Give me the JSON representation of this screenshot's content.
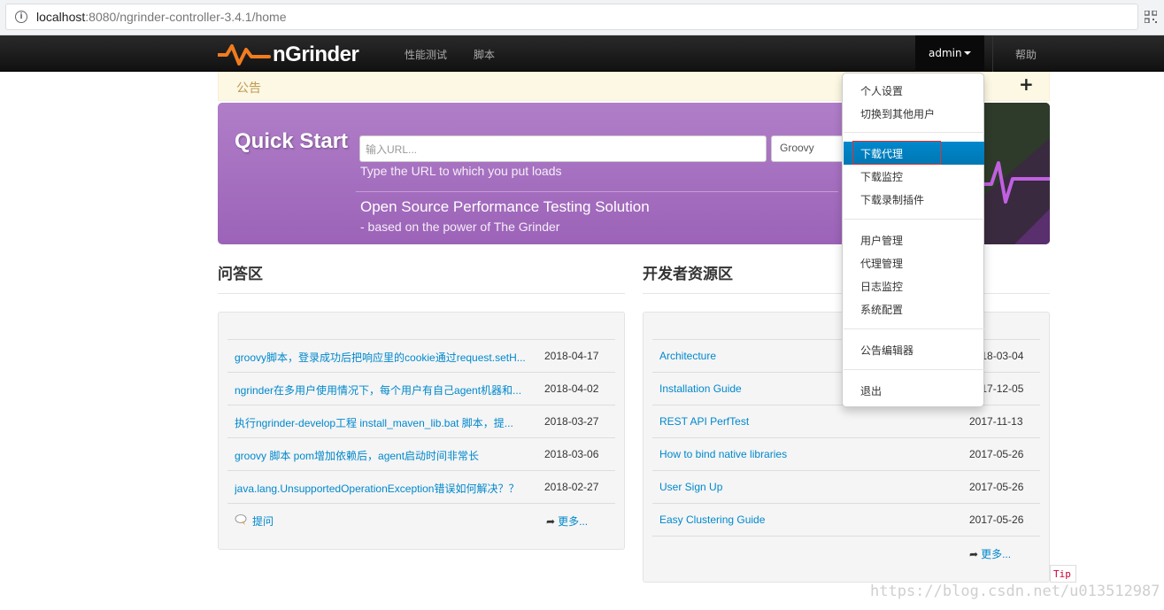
{
  "browser": {
    "url_host": "localhost",
    "url_rest": ":8080/ngrinder-controller-3.4.1/home",
    "info_icon": "info-icon",
    "qr_icon": "qr-code-icon"
  },
  "navbar": {
    "logo_text": "nGrinder",
    "items": [
      "性能测试",
      "脚本"
    ],
    "user": "admin",
    "help": "帮助"
  },
  "notice": {
    "title": "公告",
    "add_icon": "plus-icon"
  },
  "quickstart": {
    "title": "Quick Start",
    "url_placeholder": "输入URL...",
    "lang_selected": "Groovy",
    "hint": "Type the URL to which you put loads",
    "subtitle1": "Open Source Performance Testing Solution",
    "subtitle2": "- based on the power of The Grinder"
  },
  "qa": {
    "title": "问答区",
    "rows": [
      {
        "title": "groovy脚本，登录成功后把响应里的cookie通过request.setH...",
        "date": "2018-04-17"
      },
      {
        "title": "ngrinder在多用户使用情况下，每个用户有自己agent机器和...",
        "date": "2018-04-02"
      },
      {
        "title": "执行ngrinder-develop工程 install_maven_lib.bat 脚本，提...",
        "date": "2018-03-27"
      },
      {
        "title": "groovy 脚本 pom增加依赖后，agent启动时间非常长",
        "date": "2018-03-06"
      },
      {
        "title": "java.lang.UnsupportedOperationException错误如何解决？？",
        "date": "2018-02-27"
      }
    ],
    "ask": "提问",
    "more": "更多..."
  },
  "dev": {
    "title": "开发者资源区",
    "rows": [
      {
        "title": "Architecture",
        "date": "2018-03-04"
      },
      {
        "title": "Installation Guide",
        "date": "2017-12-05"
      },
      {
        "title": "REST API PerfTest",
        "date": "2017-11-13"
      },
      {
        "title": "How to bind native libraries",
        "date": "2017-05-26"
      },
      {
        "title": "User Sign Up",
        "date": "2017-05-26"
      },
      {
        "title": "Easy Clustering Guide",
        "date": "2017-05-26"
      }
    ],
    "more": "更多..."
  },
  "dropdown": {
    "groups": [
      [
        "个人设置",
        "切换到其他用户"
      ],
      [
        "下载代理",
        "下载监控",
        "下载录制插件"
      ],
      [
        "用户管理",
        "代理管理",
        "日志监控",
        "系统配置"
      ],
      [
        "公告编辑器"
      ],
      [
        "退出"
      ]
    ]
  },
  "tip": "Tip",
  "watermark": "https://blog.csdn.net/u013512987"
}
